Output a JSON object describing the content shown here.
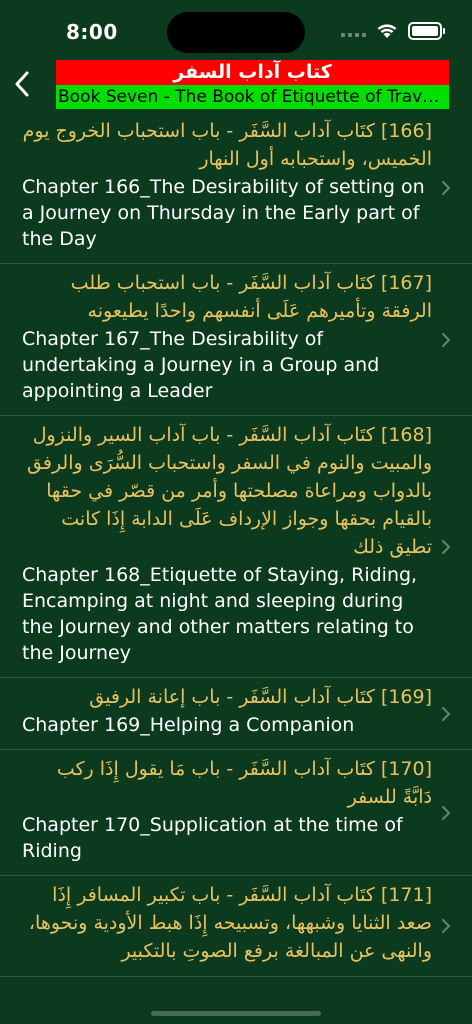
{
  "status_bar": {
    "time": "8:00",
    "battery_level": 1.0
  },
  "header": {
    "title_arabic": "كتاب آداب السفر",
    "title_english": "Book Seven - The Book of Etiquette of Traveli..."
  },
  "colors": {
    "background": "#0c3a1e",
    "arabic_text": "#e8c260",
    "english_text": "#ffffff",
    "title_arabic_bg": "#ff0000",
    "title_english_bg": "#00e000"
  },
  "icons": {
    "back": "chevron-left-icon",
    "row": "chevron-right-icon"
  },
  "chapters": [
    {
      "arabic": "[166] كتَاب آداب السَّفَر - باب استحباب الخروج يوم الخميس، واستحبابه أول النهار",
      "english": "Chapter 166_The Desirability of setting on a Journey on Thursday in the Early part of the Day"
    },
    {
      "arabic": "[167] كتَاب آداب السَّفَر - باب استحباب طلب الرفقة وتأميرهم عَلَى أنفسهم واحدًا يطيعونه",
      "english": "Chapter 167_The Desirability of undertaking a Journey in a Group and appointing a Leader"
    },
    {
      "arabic": "[168] كتَاب آداب السَّفَر - باب آداب السير والنزول والمبيت والنوم في السفر واستحباب السُّرَى والرفق بالدواب ومراعاة مصلحتها وأمر من قصّر في حقها بالقيام بحقها وجواز الإرداف عَلَى الدابة إِذَا كانت تطيق ذلك",
      "english": "Chapter 168_Etiquette of Staying, Riding, Encamping at night and sleeping during the Journey and other matters relating to the Journey"
    },
    {
      "arabic": "[169] كتَاب آداب السَّفَر - باب إعانة الرفيق",
      "english": "Chapter 169_Helping a Companion"
    },
    {
      "arabic": "[170] كتَاب آداب السَّفَر - باب مَا يقول إِذَا ركب دَابَّةً للسفر",
      "english": "Chapter 170_Supplication at the time of Riding"
    },
    {
      "arabic": "[171] كتَاب آداب السَّفَر - باب تكبير المسافر إِذَا صعد الثنايا وشبهها، وتسبيحه إِذَا هبط الأودية ونحوها، والنهى عن المبالغة برفع الصوتِ بالتكبير",
      "english": ""
    }
  ]
}
